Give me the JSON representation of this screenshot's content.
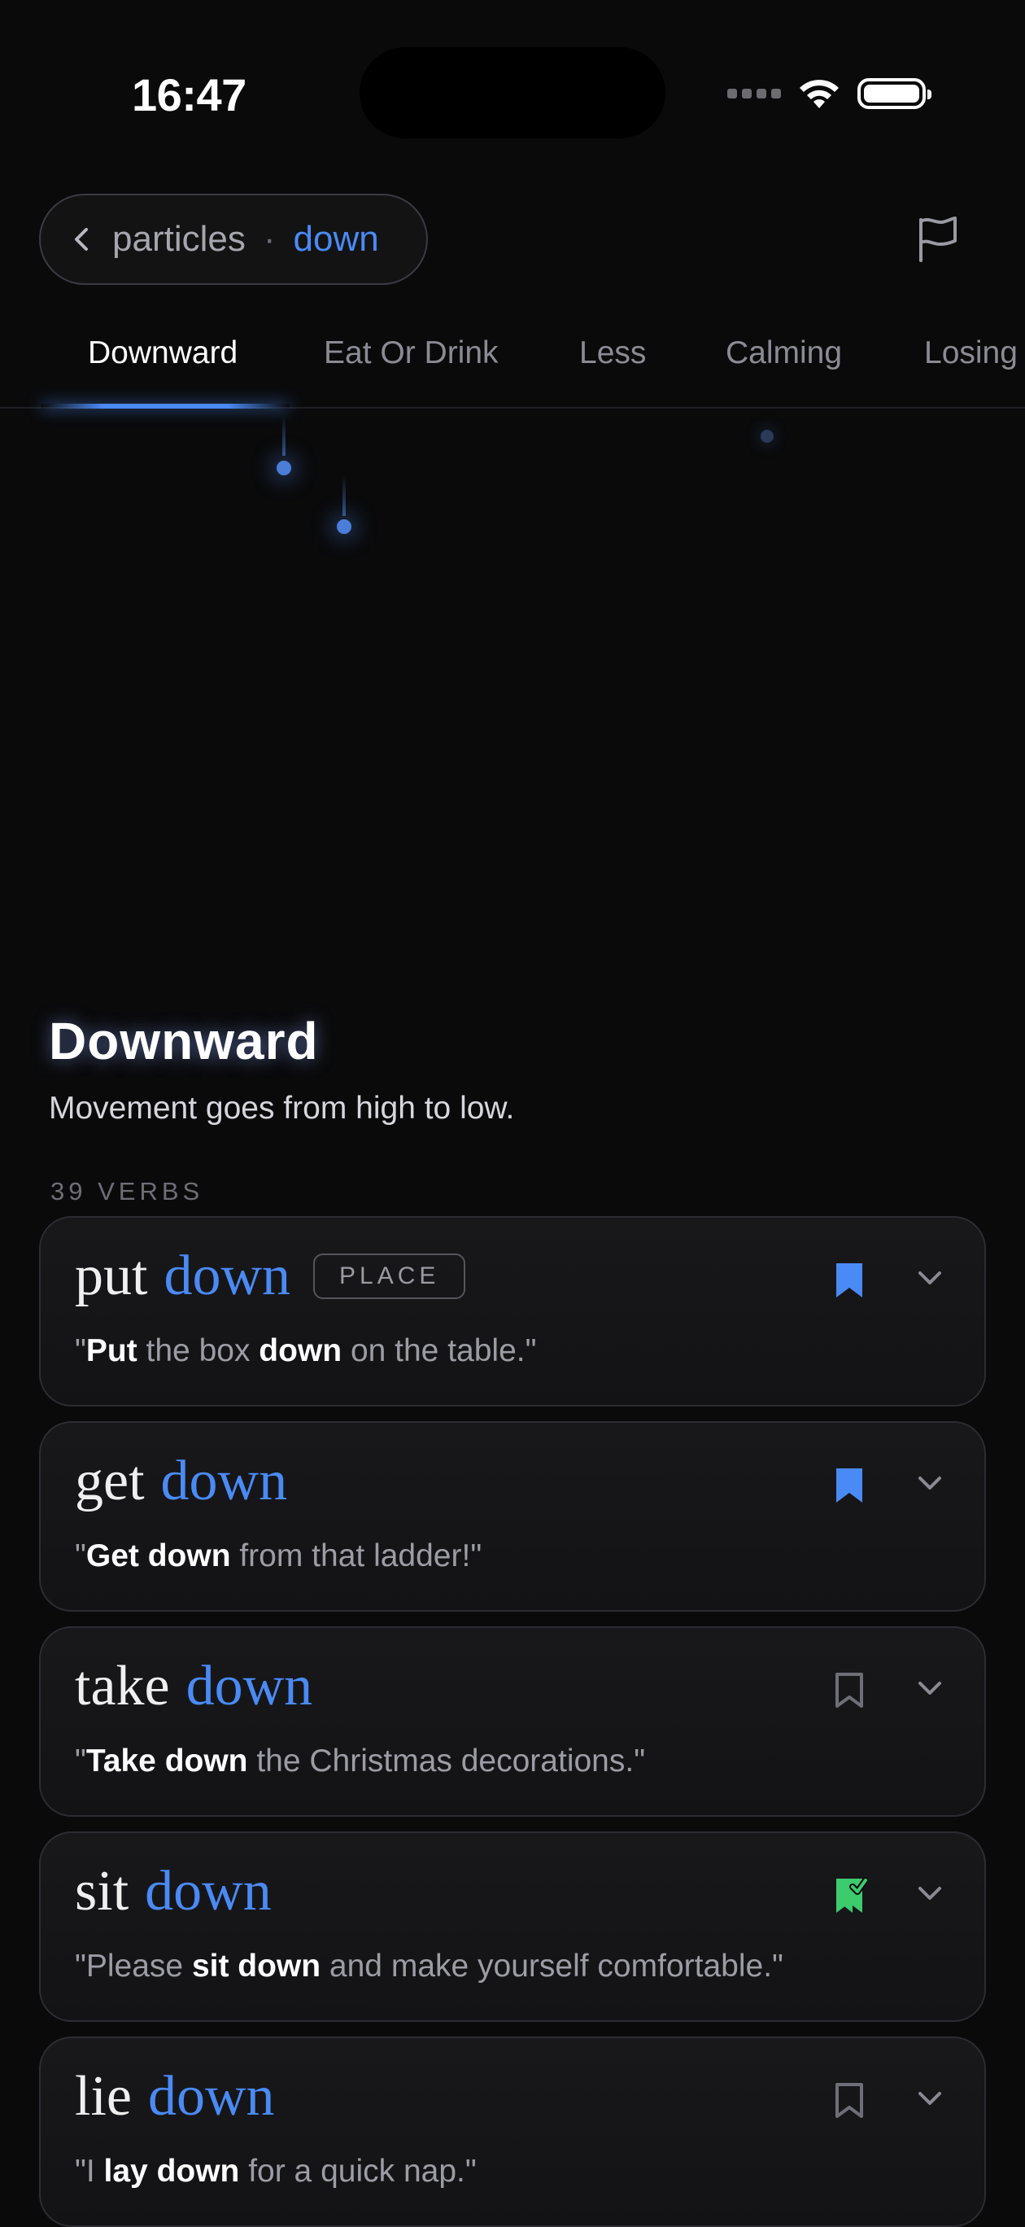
{
  "status_bar": {
    "time": "16:47"
  },
  "breadcrumb": {
    "parent": "particles",
    "separator": "·",
    "current": "down"
  },
  "tabs": [
    "Downward",
    "Eat Or Drink",
    "Less",
    "Calming",
    "Losing"
  ],
  "active_tab": "Downward",
  "section": {
    "title": "Downward",
    "description": "Movement goes from high to low.",
    "count": "39 VERBS"
  },
  "colors": {
    "accent": "#4a8af4",
    "learned": "#3ccc6e",
    "background": "#0a0a0b"
  },
  "verbs": [
    {
      "verb": "put",
      "particle": "down",
      "tag": "PLACE",
      "bookmark": "saved",
      "example": {
        "open": "\"",
        "b1": "Put",
        "m1": " the box ",
        "b2": "down",
        "m2": " on the table.\""
      }
    },
    {
      "verb": "get",
      "particle": "down",
      "bookmark": "saved",
      "example": {
        "open": "\"",
        "b1": "Get down",
        "m1": " from that ladder!\""
      }
    },
    {
      "verb": "take",
      "particle": "down",
      "bookmark": "empty",
      "example": {
        "open": "\"",
        "b1": "Take down",
        "m1": " the Christmas decorations.\""
      }
    },
    {
      "verb": "sit",
      "particle": "down",
      "bookmark": "learned",
      "example": {
        "open": "\"Please ",
        "b1": "sit down",
        "m1": " and make yourself comfortable.\""
      }
    },
    {
      "verb": "lie",
      "particle": "down",
      "bookmark": "empty",
      "example": {
        "open": "\"I ",
        "b1": "lay down",
        "m1": " for a quick nap.\""
      }
    }
  ]
}
